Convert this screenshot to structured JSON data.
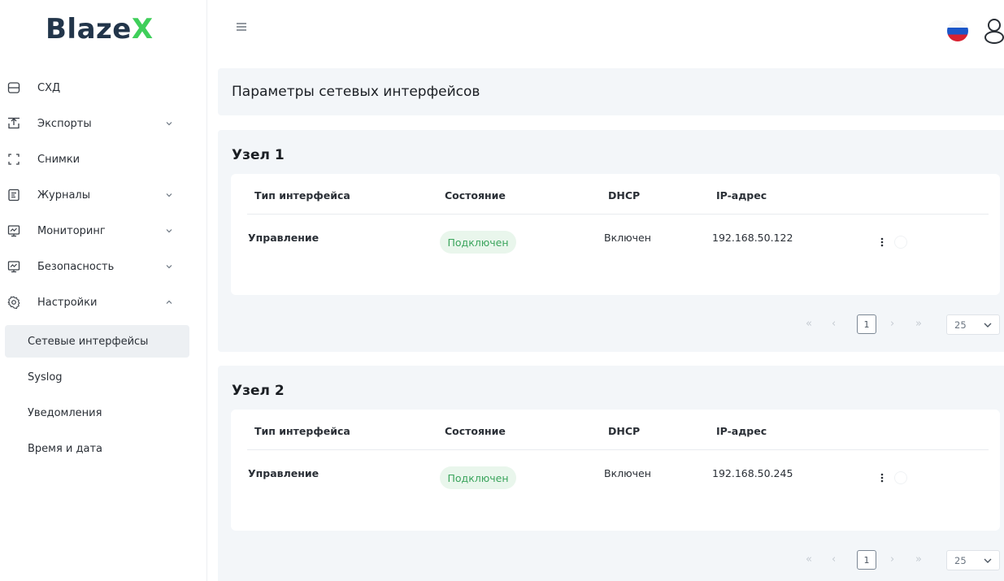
{
  "app": {
    "logo_main": "Blaze",
    "logo_accent": "X"
  },
  "sidebar": {
    "items": [
      {
        "label": "СХД",
        "icon": "storage-icon",
        "has_chevron": false
      },
      {
        "label": "Экспорты",
        "icon": "export-icon",
        "has_chevron": true
      },
      {
        "label": "Снимки",
        "icon": "snapshot-icon",
        "has_chevron": false
      },
      {
        "label": "Журналы",
        "icon": "journal-icon",
        "has_chevron": true
      },
      {
        "label": "Мониторинг",
        "icon": "monitoring-icon",
        "has_chevron": true
      },
      {
        "label": "Безопасность",
        "icon": "security-icon",
        "has_chevron": true
      },
      {
        "label": "Настройки",
        "icon": "settings-icon",
        "has_chevron": true,
        "expanded": true
      }
    ],
    "subitems": [
      {
        "label": "Сетевые интерфейсы",
        "active": true
      },
      {
        "label": "Syslog",
        "active": false
      },
      {
        "label": "Уведомления",
        "active": false
      },
      {
        "label": "Время и дата",
        "active": false
      }
    ]
  },
  "header": {
    "menu_icon": "hamburger-icon",
    "language": "russian-flag-icon",
    "user_icon": "user-icon"
  },
  "page": {
    "title": "Параметры сетевых интерфейсов"
  },
  "columns": [
    "Тип интерфейса",
    "Состояние",
    "DHCP",
    "IP-адрес"
  ],
  "nodes": [
    {
      "title": "Узел 1",
      "rows": [
        {
          "type": "Управление",
          "status": "Подключен",
          "dhcp": "Включен",
          "ip": "192.168.50.122"
        }
      ],
      "pager": {
        "first": "«",
        "prev": "‹",
        "page": "1",
        "next": "›",
        "last": "»",
        "page_size": "25"
      }
    },
    {
      "title": "Узел 2",
      "rows": [
        {
          "type": "Управление",
          "status": "Подключен",
          "dhcp": "Включен",
          "ip": "192.168.50.245"
        }
      ],
      "pager": {
        "first": "«",
        "prev": "‹",
        "page": "1",
        "next": "›",
        "last": "»",
        "page_size": "25"
      }
    }
  ],
  "colors": {
    "accent_green": "#3fcf5a",
    "status_bg": "#e9f6ec",
    "status_text": "#3aa45c",
    "card_bg": "#f3f6f9",
    "active_bg": "#edf0f3"
  }
}
